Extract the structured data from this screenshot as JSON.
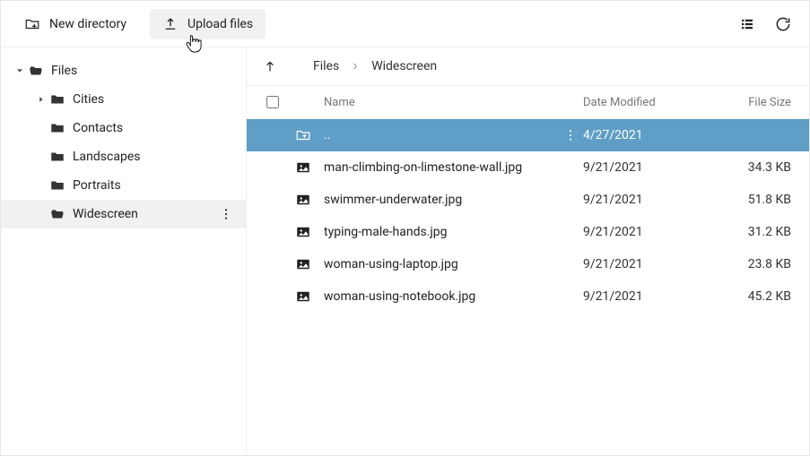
{
  "toolbar": {
    "new_dir_label": "New directory",
    "upload_label": "Upload files"
  },
  "tree": {
    "root": {
      "label": "Files"
    },
    "children": [
      {
        "label": "Cities",
        "expandable": true,
        "selected": false
      },
      {
        "label": "Contacts",
        "expandable": false,
        "selected": false
      },
      {
        "label": "Landscapes",
        "expandable": false,
        "selected": false
      },
      {
        "label": "Portraits",
        "expandable": false,
        "selected": false
      },
      {
        "label": "Widescreen",
        "expandable": false,
        "selected": true
      }
    ]
  },
  "breadcrumb": {
    "items": [
      "Files",
      "Widescreen"
    ]
  },
  "columns": {
    "name": "Name",
    "date": "Date Modified",
    "size": "File Size"
  },
  "rows": [
    {
      "kind": "up",
      "name": "..",
      "date": "4/27/2021",
      "size": ""
    },
    {
      "kind": "img",
      "name": "man-climbing-on-limestone-wall.jpg",
      "date": "9/21/2021",
      "size": "34.3 KB"
    },
    {
      "kind": "img",
      "name": "swimmer-underwater.jpg",
      "date": "9/21/2021",
      "size": "51.8 KB"
    },
    {
      "kind": "img",
      "name": "typing-male-hands.jpg",
      "date": "9/21/2021",
      "size": "31.2 KB"
    },
    {
      "kind": "img",
      "name": "woman-using-laptop.jpg",
      "date": "9/21/2021",
      "size": "23.8 KB"
    },
    {
      "kind": "img",
      "name": "woman-using-notebook.jpg",
      "date": "9/21/2021",
      "size": "45.2 KB"
    }
  ]
}
